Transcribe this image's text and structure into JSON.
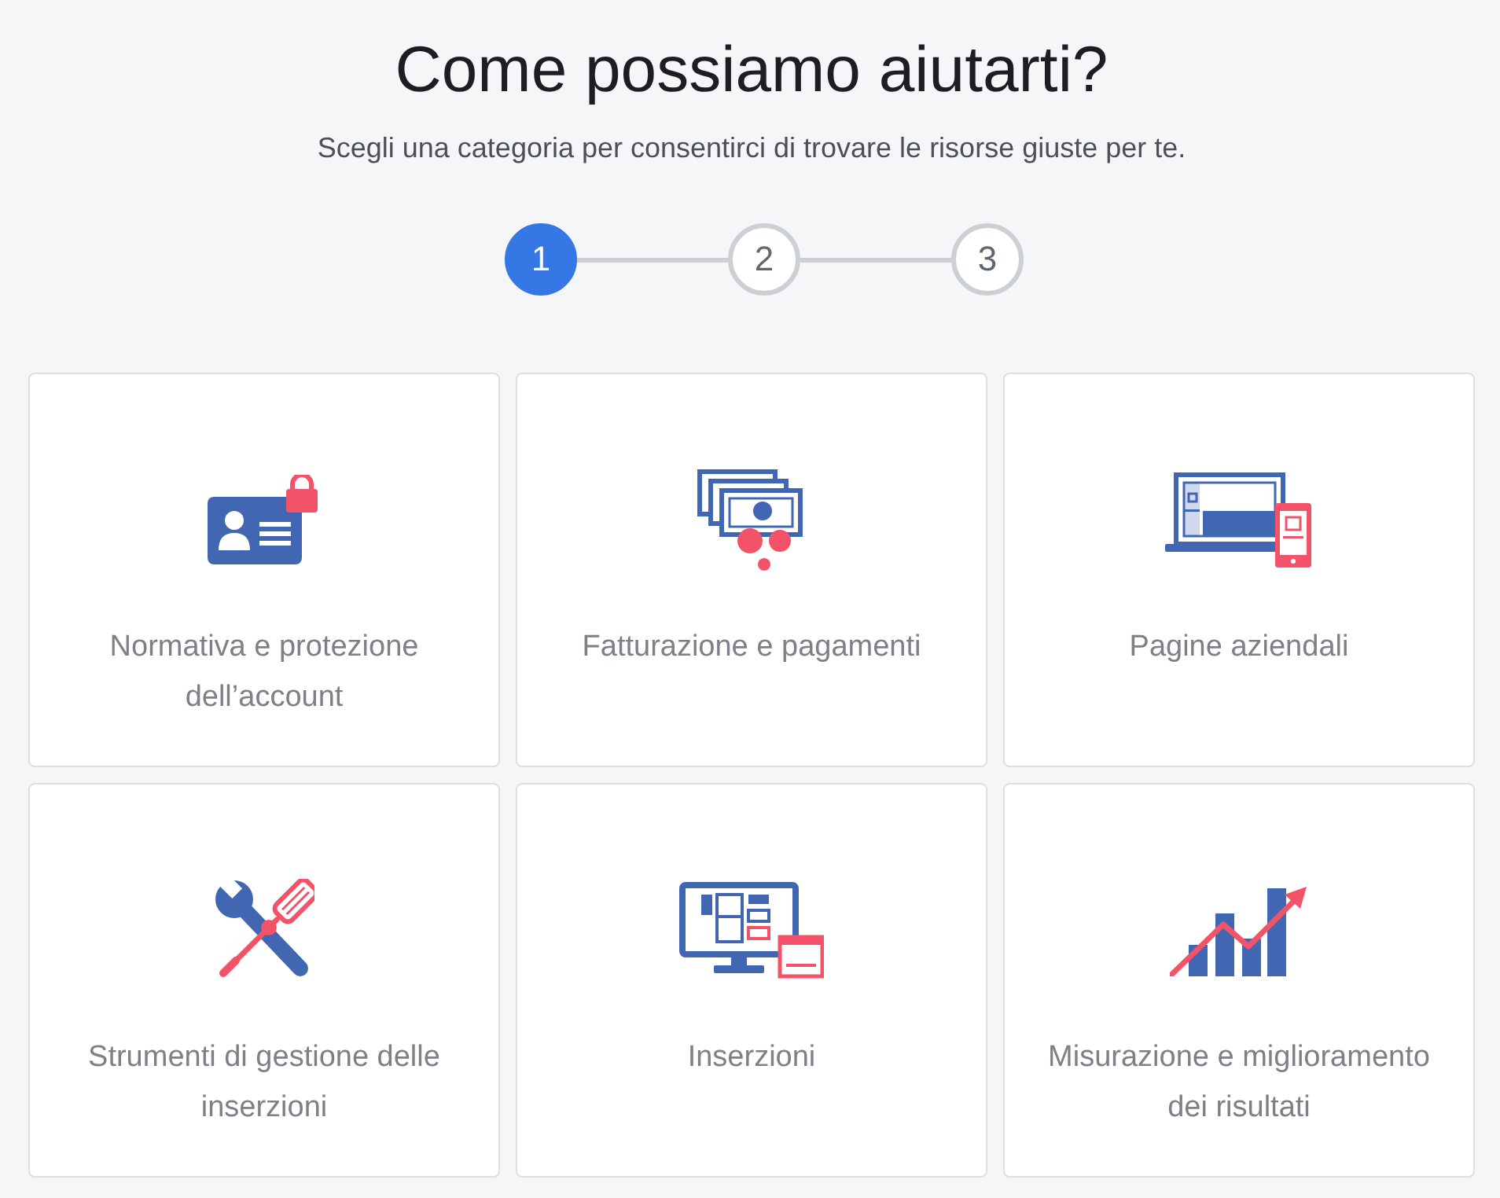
{
  "header": {
    "title": "Come possiamo aiutarti?",
    "subtitle": "Scegli una categoria per consentirci di trovare le risorse giuste per te."
  },
  "steps": [
    {
      "label": "1",
      "selected": true
    },
    {
      "label": "2",
      "selected": false
    },
    {
      "label": "3",
      "selected": false
    }
  ],
  "categories": [
    {
      "kind": "id-card",
      "label": "Normativa e protezione dell’account"
    },
    {
      "kind": "bills",
      "label": "Fatturazione e pagamenti"
    },
    {
      "kind": "laptop-phone",
      "label": "Pagine aziendali"
    },
    {
      "kind": "tools",
      "label": "Strumenti di gestione delle inserzioni"
    },
    {
      "kind": "monitor",
      "label": "Inserzioni"
    },
    {
      "kind": "chart",
      "label": "Misurazione e miglioramento dei risultati"
    }
  ]
}
